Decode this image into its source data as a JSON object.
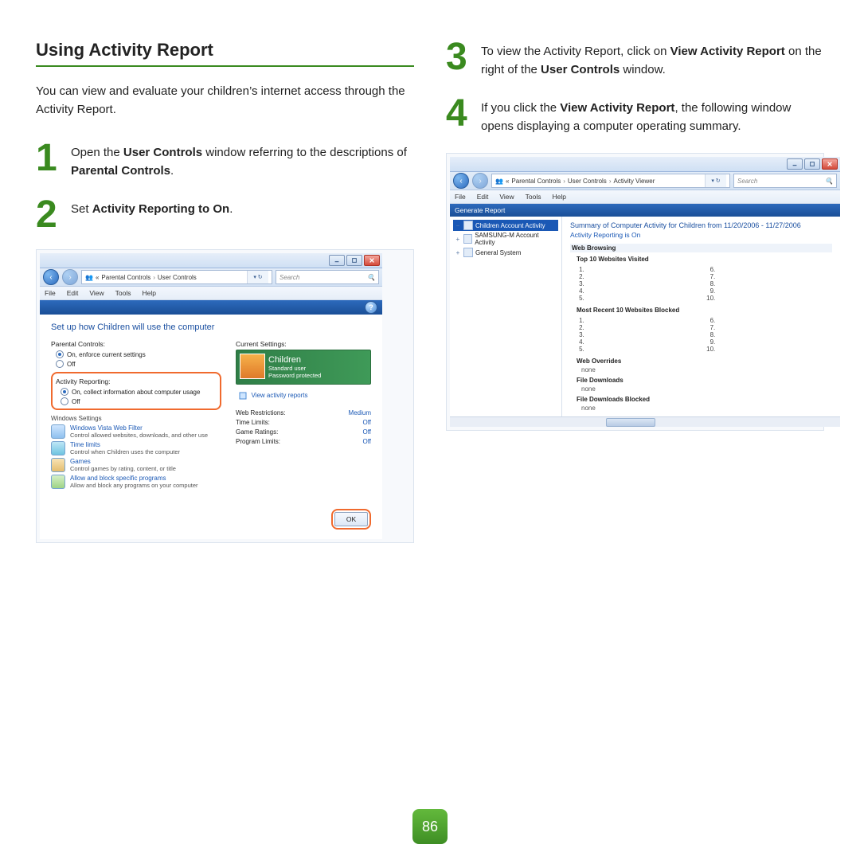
{
  "page_number": "86",
  "heading": "Using Activity Report",
  "intro": "You can view and evaluate your children’s internet access through the Activity Report.",
  "steps": {
    "s1": {
      "num": "1",
      "pre": "Open the ",
      "b1": "User Controls",
      "mid": " window referring to the descriptions of ",
      "b2": "Parental Controls",
      "post": "."
    },
    "s2": {
      "num": "2",
      "pre": "Set ",
      "b1": "Activity Reporting to On",
      "post": "."
    },
    "s3": {
      "num": "3",
      "pre": "To view the Activity Report, click on ",
      "b1": "View Activity Report",
      "mid": " on the right of the ",
      "b2": "User Controls",
      "post": " window."
    },
    "s4": {
      "num": "4",
      "pre": "If you click the ",
      "b1": "View Activity Report",
      "post": ", the following window opens displaying a computer operating summary."
    }
  },
  "shot1": {
    "breadcrumb": {
      "a": "Parental Controls",
      "b": "User Controls"
    },
    "search_ph": "Search",
    "menu": {
      "file": "File",
      "edit": "Edit",
      "view": "View",
      "tools": "Tools",
      "help": "Help"
    },
    "title": "Set up how Children will use the computer",
    "pc_label": "Parental Controls:",
    "pc_on": "On, enforce current settings",
    "pc_off": "Off",
    "ar_label": "Activity Reporting:",
    "ar_on": "On, collect information about computer usage",
    "ar_off": "Off",
    "ws_label": "Windows Settings",
    "ws": {
      "w1": {
        "t": "Windows Vista Web Filter",
        "d": "Control allowed websites, downloads, and other use"
      },
      "w2": {
        "t": "Time limits",
        "d": "Control when Children uses the computer"
      },
      "w3": {
        "t": "Games",
        "d": "Control games by rating, content, or title"
      },
      "w4": {
        "t": "Allow and block specific programs",
        "d": "Allow and block any programs on your computer"
      }
    },
    "cs_label": "Current Settings:",
    "user": {
      "name": "Children",
      "role": "Standard user",
      "pw": "Password protected"
    },
    "view_activity": "View activity reports",
    "cs": {
      "r1": {
        "k": "Web Restrictions:",
        "v": "Medium"
      },
      "r2": {
        "k": "Time Limits:",
        "v": "Off"
      },
      "r3": {
        "k": "Game Ratings:",
        "v": "Off"
      },
      "r4": {
        "k": "Program Limits:",
        "v": "Off"
      }
    },
    "ok": "OK"
  },
  "shot2": {
    "breadcrumb": {
      "a": "Parental Controls",
      "b": "User Controls",
      "c": "Activity Viewer"
    },
    "search_ph": "Search",
    "menu": {
      "file": "File",
      "edit": "Edit",
      "view": "View",
      "tools": "Tools",
      "help": "Help"
    },
    "gen": "Generate Report",
    "tree": {
      "t1": "Children Account Activity",
      "t2": "SAMSUNG-M Account Activity",
      "t3": "General System"
    },
    "summary": "Summary of Computer Activity for Children from 11/20/2006 - 11/27/2006",
    "ar_on": "Activity Reporting is On",
    "sec": {
      "web": "Web Browsing",
      "top10": "Top 10 Websites Visited",
      "blocked": "Most Recent 10 Websites Blocked",
      "overrides": "Web Overrides",
      "none1": "none",
      "fdl": "File Downloads",
      "none2": "none",
      "fdlb": "File Downloads Blocked",
      "none3": "none"
    }
  }
}
